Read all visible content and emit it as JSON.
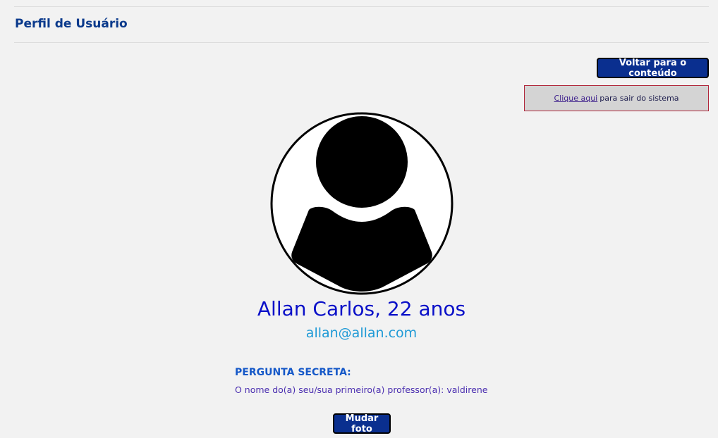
{
  "header": {
    "title": "Perfil de Usuário"
  },
  "actions": {
    "back_label": "Voltar para o conteúdo",
    "change_photo_label": "Mudar foto"
  },
  "logout": {
    "link_text": "Clique aqui",
    "message": "para sair do sistema"
  },
  "profile": {
    "avatar_icon": "user-silhouette-icon",
    "name_age": "Allan Carlos, 22 anos",
    "email": "allan@allan.com"
  },
  "security": {
    "label": "PERGUNTA SECRETA:",
    "question": "O nome do(a) seu/sua primeiro(a) professor(a): valdirene"
  },
  "colors": {
    "background": "#f2f2f2",
    "title": "#0b3a8c",
    "button": "#0a2f8f",
    "name": "#0a10c8",
    "email": "#1f9ad6",
    "secret_label": "#1558c8",
    "secret_value": "#4b2fb0",
    "logout_border": "#b0263a"
  }
}
